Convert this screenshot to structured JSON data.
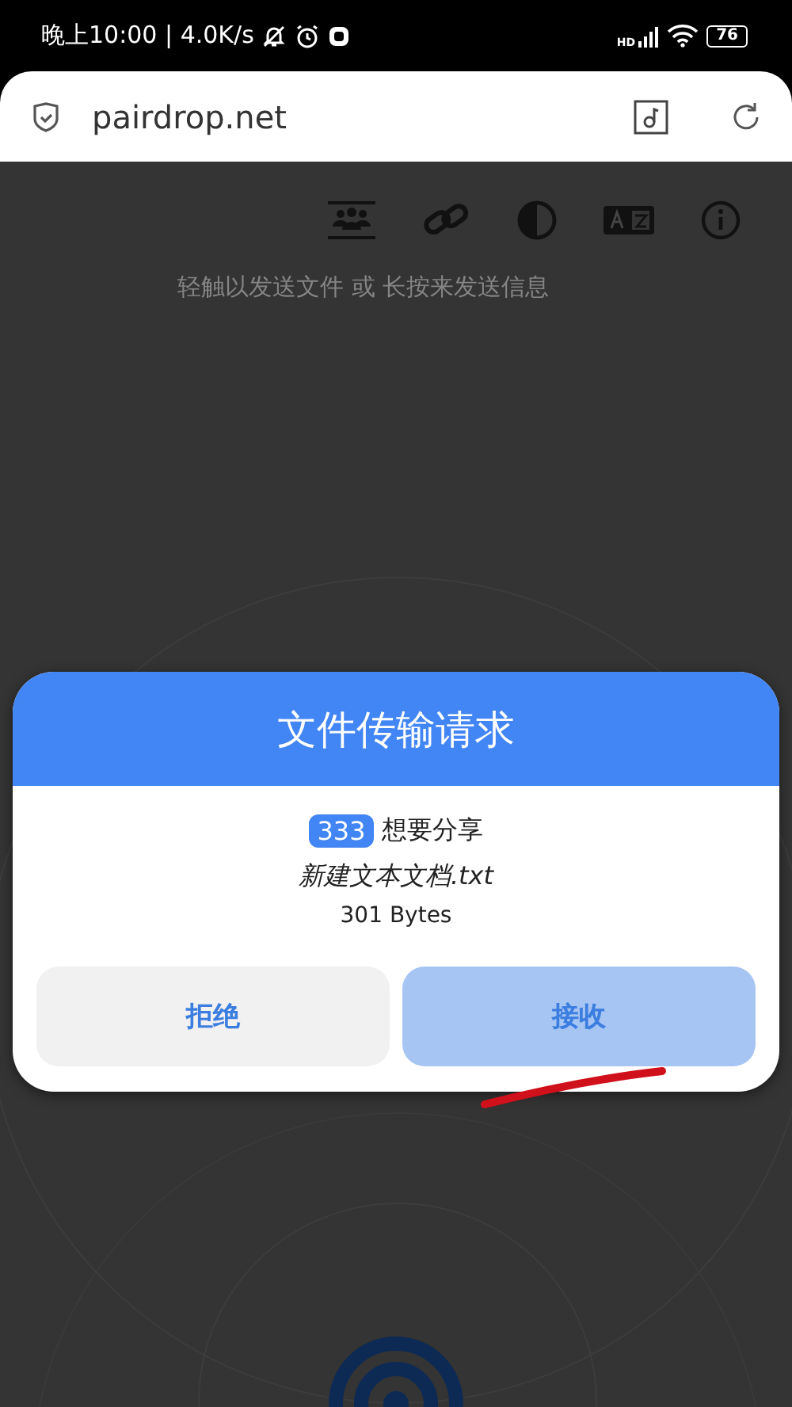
{
  "status_bar": {
    "time": "晚上10:00 | 4.0K/s",
    "signal_label": "HD",
    "battery": "76"
  },
  "address_bar": {
    "url": "pairdrop.net"
  },
  "hint": "轻触以发送文件 或 长按来发送信息",
  "dialog": {
    "title": "文件传输请求",
    "sender": "333",
    "message": "想要分享",
    "file_name": "新建文本文档.txt",
    "file_size": "301 Bytes",
    "buttons": [
      {
        "label": "拒绝",
        "kind": "secondary"
      },
      {
        "label": "接收",
        "kind": "primary"
      }
    ]
  }
}
